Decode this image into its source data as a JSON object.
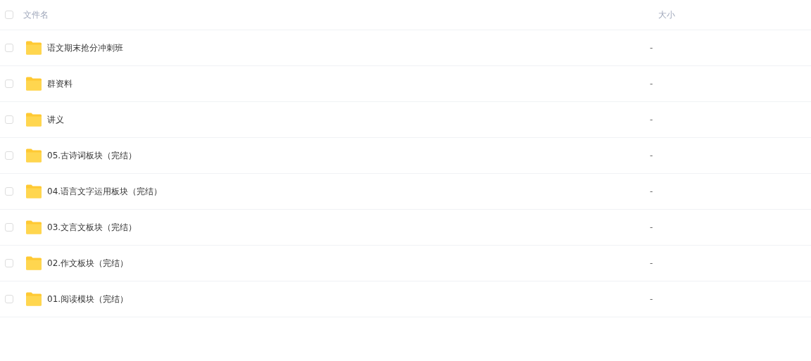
{
  "table": {
    "select_all": {
      "checked": false
    },
    "columns": [
      "文件名",
      "大小"
    ],
    "rows": [
      {
        "name": "语文期末抢分冲刺班",
        "size": "-",
        "checked": false
      },
      {
        "name": "群资料",
        "size": "-",
        "checked": false
      },
      {
        "name": "讲义",
        "size": "-",
        "checked": false
      },
      {
        "name": "05.古诗词板块（完结）",
        "size": "-",
        "checked": false
      },
      {
        "name": "04.语言文字运用板块（完结）",
        "size": "-",
        "checked": false
      },
      {
        "name": "03.文言文板块（完结）",
        "size": "-",
        "checked": false
      },
      {
        "name": "02.作文板块（完结）",
        "size": "-",
        "checked": false
      },
      {
        "name": "01.阅读模块（完结）",
        "size": "-",
        "checked": false
      }
    ]
  }
}
